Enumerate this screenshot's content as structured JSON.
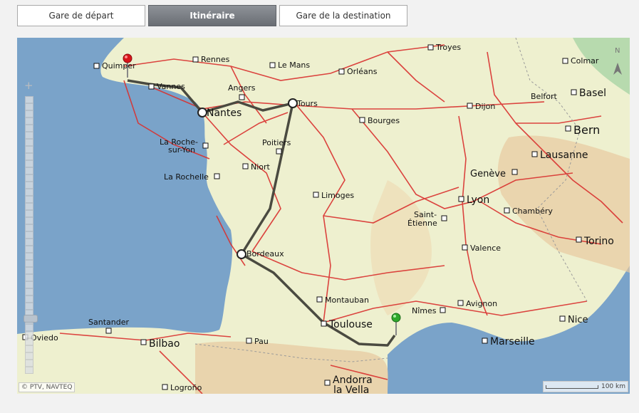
{
  "tabs": [
    {
      "id": "depart",
      "label": "Gare de départ",
      "active": false
    },
    {
      "id": "itineraire",
      "label": "Itinéraire",
      "active": true
    },
    {
      "id": "destination",
      "label": "Gare de la destination",
      "active": false
    }
  ],
  "map": {
    "copyright": "© PTV, NAVTEQ",
    "scale_label": "100 km",
    "cities": [
      {
        "name": "Troyes"
      },
      {
        "name": "Colmar"
      },
      {
        "name": "Rennes"
      },
      {
        "name": "Quimper"
      },
      {
        "name": "Le Mans"
      },
      {
        "name": "Orléans"
      },
      {
        "name": "Vannes"
      },
      {
        "name": "Angers"
      },
      {
        "name": "Belfort"
      },
      {
        "name": "Basel"
      },
      {
        "name": "Nantes"
      },
      {
        "name": "Tours"
      },
      {
        "name": "Dijon"
      },
      {
        "name": "Bourges"
      },
      {
        "name": "Bern"
      },
      {
        "name": "La Roche-"
      },
      {
        "name": "sur-Yon"
      },
      {
        "name": "Poitiers"
      },
      {
        "name": "Lausanne"
      },
      {
        "name": "Niort"
      },
      {
        "name": "La Rochelle"
      },
      {
        "name": "Genève"
      },
      {
        "name": "Limoges"
      },
      {
        "name": "Lyon"
      },
      {
        "name": "Saint-"
      },
      {
        "name": "Étienne"
      },
      {
        "name": "Chambéry"
      },
      {
        "name": "Bordeaux"
      },
      {
        "name": "Torino"
      },
      {
        "name": "Valence"
      },
      {
        "name": "Montauban"
      },
      {
        "name": "Avignon"
      },
      {
        "name": "Nîmes"
      },
      {
        "name": "Santander"
      },
      {
        "name": "Toulouse"
      },
      {
        "name": "Nice"
      },
      {
        "name": "Oviedo"
      },
      {
        "name": "Pau"
      },
      {
        "name": "Marseille"
      },
      {
        "name": "Bilbao"
      },
      {
        "name": "Andorra"
      },
      {
        "name": "la Vella"
      },
      {
        "name": "Logroño"
      }
    ]
  },
  "colors": {
    "sea": "#7aa3c9",
    "land": "#eef0cf",
    "road": "#d9312f",
    "route": "#4a4a40",
    "start_pin": "#d8141a",
    "end_pin": "#2ea82c"
  }
}
